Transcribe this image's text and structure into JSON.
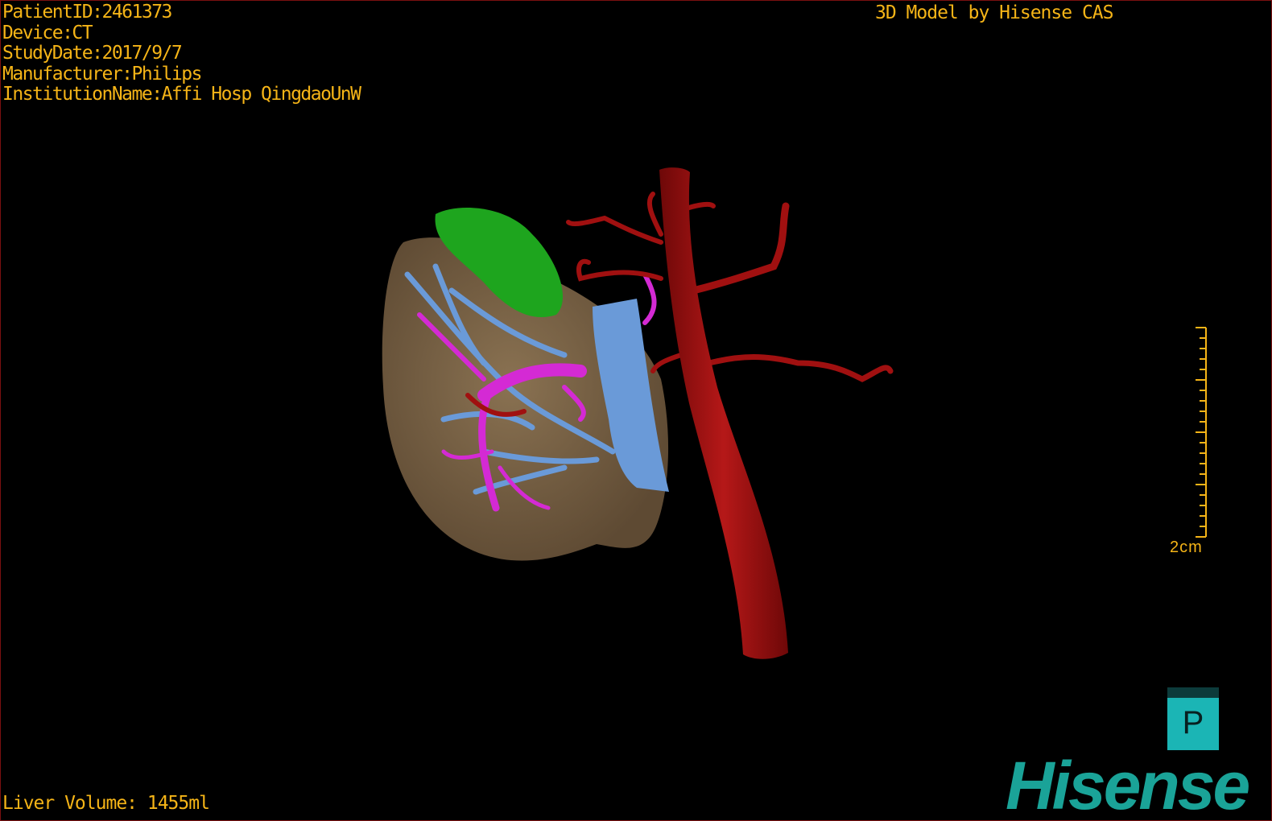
{
  "overlay": {
    "patient_id": "PatientID:2461373",
    "device": "Device:CT",
    "study_date": "StudyDate:2017/9/7",
    "manufacturer": "Manufacturer:Philips",
    "institution": "InstitutionName:Affi Hosp QingdaoUnW",
    "model_credit": "3D Model by Hisense CAS",
    "liver_volume": "Liver Volume: 1455ml"
  },
  "scale_bar": {
    "label": "2cm",
    "color": "#f5b417"
  },
  "projection_button": {
    "label": "P",
    "icon": "projection-icon"
  },
  "brand_logo": "Hisense",
  "colors": {
    "text": "#f5b417",
    "liver": "#7a6447",
    "gallbladder": "#1ea51e",
    "aorta": "#a01010",
    "vena_cava": "#6a9ad8",
    "portal_vein": "#d42ad4",
    "brand": "#1aa398"
  }
}
